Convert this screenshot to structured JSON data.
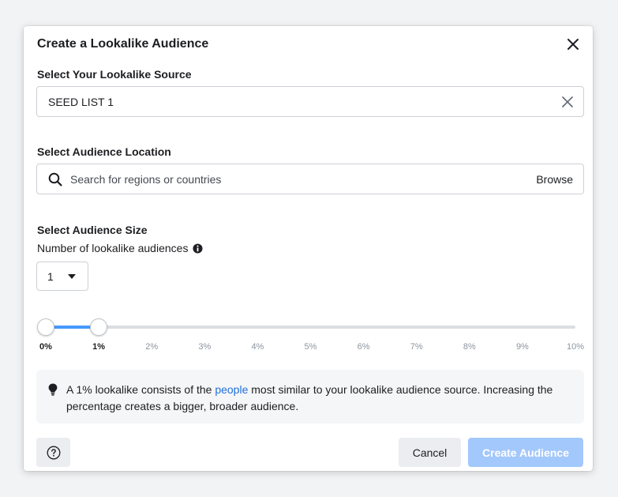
{
  "dialog": {
    "title": "Create a Lookalike Audience"
  },
  "source": {
    "label": "Select Your Lookalike Source",
    "value": "SEED LIST 1"
  },
  "location": {
    "label": "Select Audience Location",
    "placeholder": "Search for regions or countries",
    "browse_label": "Browse"
  },
  "size": {
    "label": "Select Audience Size",
    "count_label": "Number of lookalike audiences",
    "count_value": "1",
    "range_start_percent": 0,
    "range_end_percent": 1,
    "ticks": [
      "0%",
      "1%",
      "2%",
      "3%",
      "4%",
      "5%",
      "6%",
      "7%",
      "8%",
      "9%",
      "10%"
    ]
  },
  "tip": {
    "text_before": "A 1% lookalike consists of the ",
    "link": "people",
    "text_after": " most similar to your lookalike audience source. Increasing the percentage creates a bigger, broader audience."
  },
  "footer": {
    "cancel_label": "Cancel",
    "create_label": "Create Audience"
  },
  "icons": {
    "close": "close-icon",
    "clear": "clear-icon",
    "search": "search-icon",
    "info": "info-icon",
    "caret": "caret-down-icon",
    "bulb": "lightbulb-icon",
    "help": "help-icon"
  },
  "colors": {
    "accent": "#4599ff",
    "link": "#216fdb",
    "primary_disabled": "#a3c8fb"
  }
}
